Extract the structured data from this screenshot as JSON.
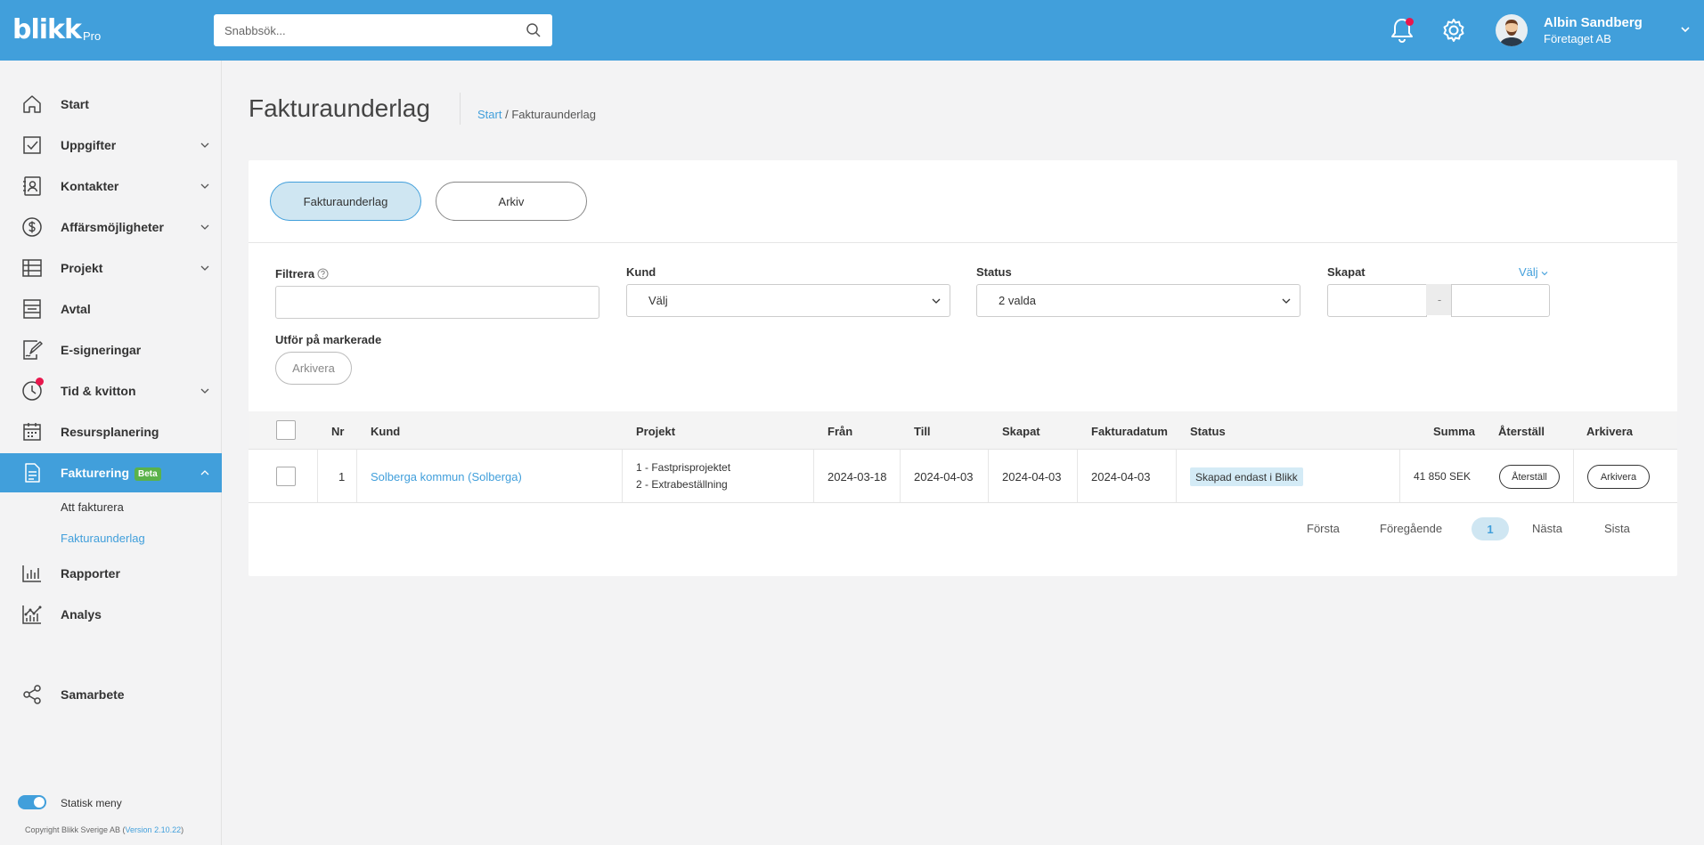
{
  "app": {
    "logo": "blikk",
    "logo_suffix": "Pro"
  },
  "search": {
    "placeholder": "Snabbsök..."
  },
  "user": {
    "name": "Albin Sandberg",
    "company": "Företaget AB"
  },
  "sidebar": {
    "items": [
      {
        "label": "Start",
        "icon": "home-icon"
      },
      {
        "label": "Uppgifter",
        "icon": "checkbox-icon"
      },
      {
        "label": "Kontakter",
        "icon": "contact-icon"
      },
      {
        "label": "Affärsmöjligheter",
        "icon": "dollar-icon"
      },
      {
        "label": "Projekt",
        "icon": "table-icon"
      },
      {
        "label": "Avtal",
        "icon": "contract-icon"
      },
      {
        "label": "E-signeringar",
        "icon": "signature-icon"
      },
      {
        "label": "Tid & kvitton",
        "icon": "clock-icon"
      },
      {
        "label": "Resursplanering",
        "icon": "calendar-icon"
      },
      {
        "label": "Fakturering",
        "icon": "invoice-icon",
        "badge": "Beta"
      },
      {
        "label": "Rapporter",
        "icon": "bar-chart-icon"
      },
      {
        "label": "Analys",
        "icon": "analytics-icon"
      },
      {
        "label": "Samarbete",
        "icon": "share-icon"
      }
    ],
    "subitems": [
      "Att fakturera",
      "Fakturaunderlag"
    ],
    "toggle_label": "Statisk meny",
    "copyright": "Copyright Blikk Sverige AB (",
    "version": "Version 2.10.22",
    "copyright_end": ")"
  },
  "page": {
    "title": "Fakturaunderlag",
    "breadcrumb": {
      "home": "Start",
      "sep": " / ",
      "current": "Fakturaunderlag"
    }
  },
  "tabs": [
    "Fakturaunderlag",
    "Arkiv"
  ],
  "filters": {
    "filter_label": "Filtrera",
    "kund_label": "Kund",
    "kund_value": "Välj",
    "status_label": "Status",
    "status_value": "2 valda",
    "skapat_label": "Skapat",
    "skapat_choose": "Välj",
    "date_sep": "-",
    "bulk_label": "Utför på markerade",
    "bulk_button": "Arkivera"
  },
  "table": {
    "headers": [
      "Nr",
      "Kund",
      "Projekt",
      "Från",
      "Till",
      "Skapat",
      "Fakturadatum",
      "Status",
      "Summa",
      "Återställ",
      "Arkivera"
    ],
    "rows": [
      {
        "nr": "1",
        "kund": "Solberga kommun (Solberga)",
        "projekt": [
          "1 - Fastprisprojektet",
          "2 - Extrabeställning"
        ],
        "fran": "2024-03-18",
        "till": "2024-04-03",
        "skapat": "2024-04-03",
        "fakturadatum": "2024-04-03",
        "status": "Skapad endast i Blikk",
        "summa": "41 850 SEK",
        "aterstall": "Återställ",
        "arkivera": "Arkivera"
      }
    ]
  },
  "pagination": {
    "first": "Första",
    "prev": "Föregående",
    "current": "1",
    "next": "Nästa",
    "last": "Sista"
  },
  "colors": {
    "primary": "#419fdb",
    "active_tab_bg": "#cfe6f2",
    "beta": "#5ab24a",
    "notification": "#e8174d"
  }
}
